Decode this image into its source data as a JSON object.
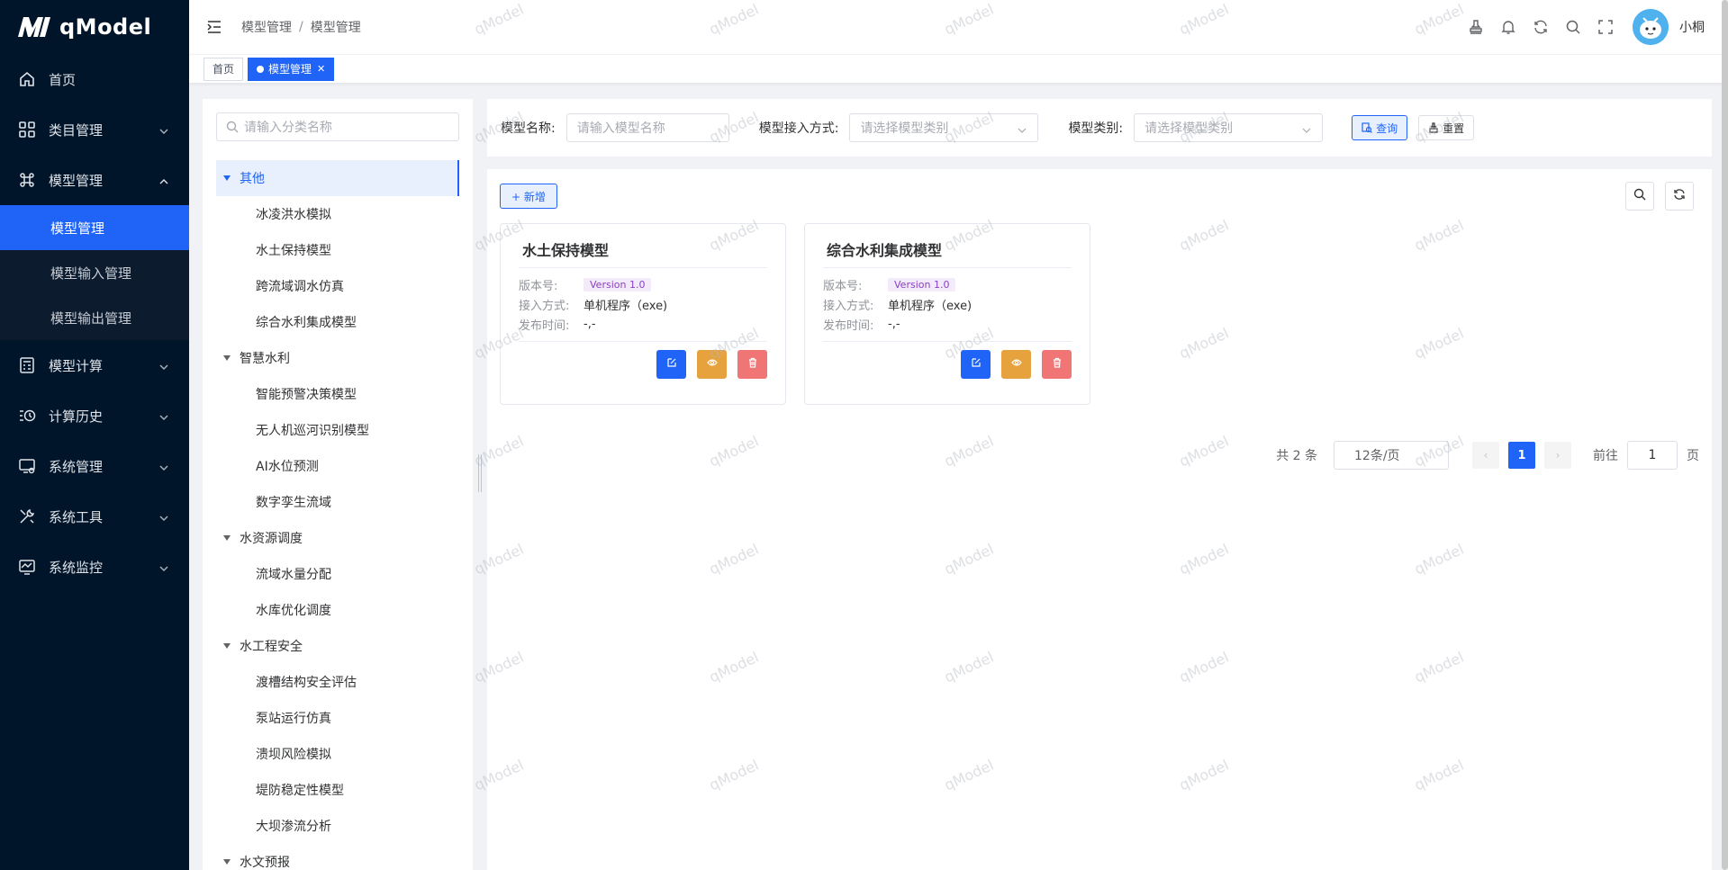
{
  "app": {
    "logo_text": "qModel",
    "watermark": "qModel"
  },
  "sidebar": {
    "items": [
      {
        "label": "首页",
        "icon": "home-icon"
      },
      {
        "label": "类目管理",
        "icon": "grid-icon"
      },
      {
        "label": "模型管理",
        "icon": "command-icon",
        "expanded": true,
        "children": [
          {
            "label": "模型管理",
            "active": true
          },
          {
            "label": "模型输入管理"
          },
          {
            "label": "模型输出管理"
          }
        ]
      },
      {
        "label": "模型计算",
        "icon": "calculator-icon"
      },
      {
        "label": "计算历史",
        "icon": "history-icon"
      },
      {
        "label": "系统管理",
        "icon": "system-icon"
      },
      {
        "label": "系统工具",
        "icon": "tools-icon"
      },
      {
        "label": "系统监控",
        "icon": "monitor-icon"
      }
    ]
  },
  "header": {
    "breadcrumb": [
      "模型管理",
      "模型管理"
    ],
    "breadcrumb_sep": "/",
    "username": "小桐"
  },
  "tags": [
    {
      "label": "首页",
      "active": false
    },
    {
      "label": "模型管理",
      "active": true
    }
  ],
  "tree": {
    "search_placeholder": "请输入分类名称",
    "nodes": [
      {
        "label": "其他",
        "type": "parent",
        "selected": true
      },
      {
        "label": "冰凌洪水模拟",
        "type": "child"
      },
      {
        "label": "水土保持模型",
        "type": "child"
      },
      {
        "label": "跨流域调水仿真",
        "type": "child"
      },
      {
        "label": "综合水利集成模型",
        "type": "child"
      },
      {
        "label": "智慧水利",
        "type": "parent"
      },
      {
        "label": "智能预警决策模型",
        "type": "child"
      },
      {
        "label": "无人机巡河识别模型",
        "type": "child"
      },
      {
        "label": "AI水位预测",
        "type": "child"
      },
      {
        "label": "数字孪生流域",
        "type": "child"
      },
      {
        "label": "水资源调度",
        "type": "parent"
      },
      {
        "label": "流域水量分配",
        "type": "child"
      },
      {
        "label": "水库优化调度",
        "type": "child"
      },
      {
        "label": "水工程安全",
        "type": "parent"
      },
      {
        "label": "渡槽结构安全评估",
        "type": "child"
      },
      {
        "label": "泵站运行仿真",
        "type": "child"
      },
      {
        "label": "溃坝风险模拟",
        "type": "child"
      },
      {
        "label": "堤防稳定性模型",
        "type": "child"
      },
      {
        "label": "大坝渗流分析",
        "type": "child"
      },
      {
        "label": "水文预报",
        "type": "parent"
      }
    ]
  },
  "filters": {
    "name_label": "模型名称:",
    "name_placeholder": "请输入模型名称",
    "access_label": "模型接入方式:",
    "access_placeholder": "请选择模型类别",
    "category_label": "模型类别:",
    "category_placeholder": "请选择模型类别",
    "query_label": "查询",
    "reset_label": "重置"
  },
  "toolbar": {
    "add_label": "+ 新增"
  },
  "cards": [
    {
      "title": "水土保持模型",
      "version_key": "版本号:",
      "version": "Version 1.0",
      "access_key": "接入方式:",
      "access": "单机程序（exe)",
      "time_key": "发布时间:",
      "time": "-,-"
    },
    {
      "title": "综合水利集成模型",
      "version_key": "版本号:",
      "version": "Version 1.0",
      "access_key": "接入方式:",
      "access": "单机程序（exe)",
      "time_key": "发布时间:",
      "time": "-,-"
    }
  ],
  "pagination": {
    "total": "共 2 条",
    "page_size": "12条/页",
    "prev": "‹",
    "next": "›",
    "current": "1",
    "goto_label": "前往",
    "goto_value": "1",
    "page_suffix": "页"
  },
  "colors": {
    "sidebar_bg": "#001529",
    "primary": "#1f64f6",
    "warning": "#e6a23c",
    "danger": "#f07575"
  }
}
